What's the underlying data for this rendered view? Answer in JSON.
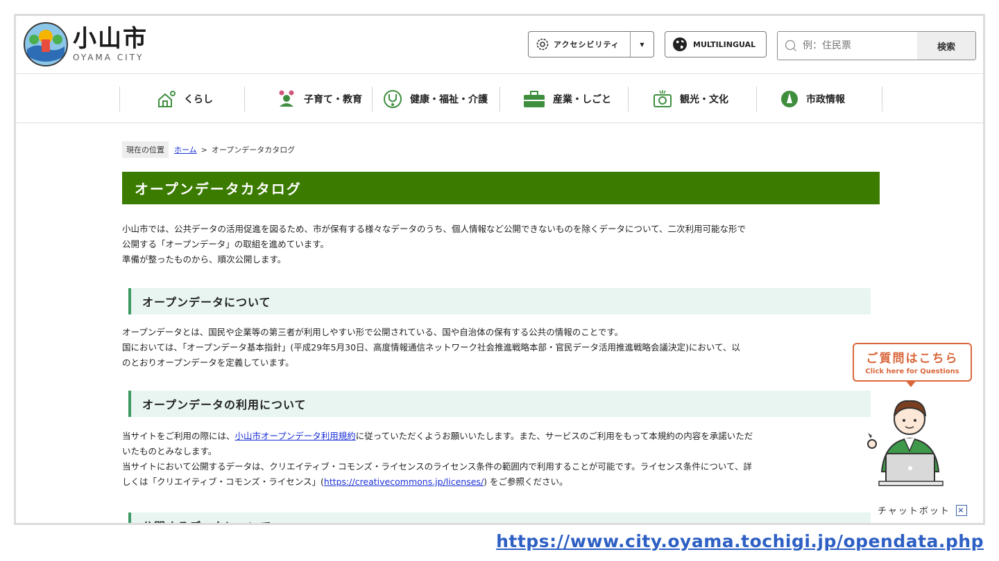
{
  "header": {
    "logo_kanji": "小山市",
    "logo_roman": "OYAMA CITY",
    "accessibility_label": "アクセシビリティ",
    "multilingual_label": "MULTILINGUAL",
    "search": {
      "placeholder": "例：住民票",
      "button": "検索"
    }
  },
  "nav": [
    {
      "label": "くらし",
      "icon": "house-icon"
    },
    {
      "label": "子育て・教育",
      "icon": "family-icon"
    },
    {
      "label": "健康・福祉・介護",
      "icon": "stethoscope-icon"
    },
    {
      "label": "産業・しごと",
      "icon": "briefcase-icon"
    },
    {
      "label": "観光・文化",
      "icon": "camera-icon"
    },
    {
      "label": "市政情報",
      "icon": "city-emblem-icon"
    }
  ],
  "breadcrumb": {
    "label": "現在の位置",
    "home": "ホーム",
    "separator": ">",
    "current": "オープンデータカタログ"
  },
  "page_title": "オープンデータカタログ",
  "intro": [
    "小山市では、公共データの活用促進を図るため、市が保有する様々なデータのうち、個人情報など公開できないものを除くデータについて、二次利用可能な形で",
    "公開する「オープンデータ」の取組を進めています。",
    "準備が整ったものから、順次公開します。"
  ],
  "sections": [
    {
      "heading": "オープンデータについて",
      "lines": [
        "オープンデータとは、国民や企業等の第三者が利用しやすい形で公開されている、国や自治体の保有する公共の情報のことです。",
        "国においては、「オープンデータ基本指針」(平成29年5月30日、高度情報通信ネットワーク社会推進戦略本部・官民データ活用推進戦略会議決定)において、以",
        "のとおりオープンデータを定義しています。"
      ]
    },
    {
      "heading": "オープンデータの利用について",
      "line1_pre": "当サイトをご利用の際には、",
      "terms_link": "小山市オープンデータ利用規約",
      "line1_post": "に従っていただくようお願いいたします。また、サービスのご利用をもって本規約の内容を承諾いただ",
      "line2": "いたものとみなします。",
      "line3": "当サイトにおいて公開するデータは、クリエイティブ・コモンズ・ライセンスのライセンス条件の範囲内で利用することが可能です。ライセンス条件について、詳",
      "line4_pre": "しくは「クリエイティブ・コモンズ・ライセンス」(",
      "cc_link": "https://creativecommons.jp/licenses/",
      "line4_post": ") をご参照ください。"
    },
    {
      "heading": "公開するデータについて"
    }
  ],
  "chatbot": {
    "bubble_jp": "ご質問はこちら",
    "bubble_en": "Click here for Questions",
    "label": "チャットボット",
    "close": "×"
  },
  "source_url": "https://www.city.oyama.tochigi.jp/opendata.php",
  "colors": {
    "title_bar": "#3b7b00",
    "heading_bg": "#e8f5f1",
    "heading_border": "#3d9a63",
    "chat_accent": "#d9663a",
    "link": "#1a2fd6"
  }
}
